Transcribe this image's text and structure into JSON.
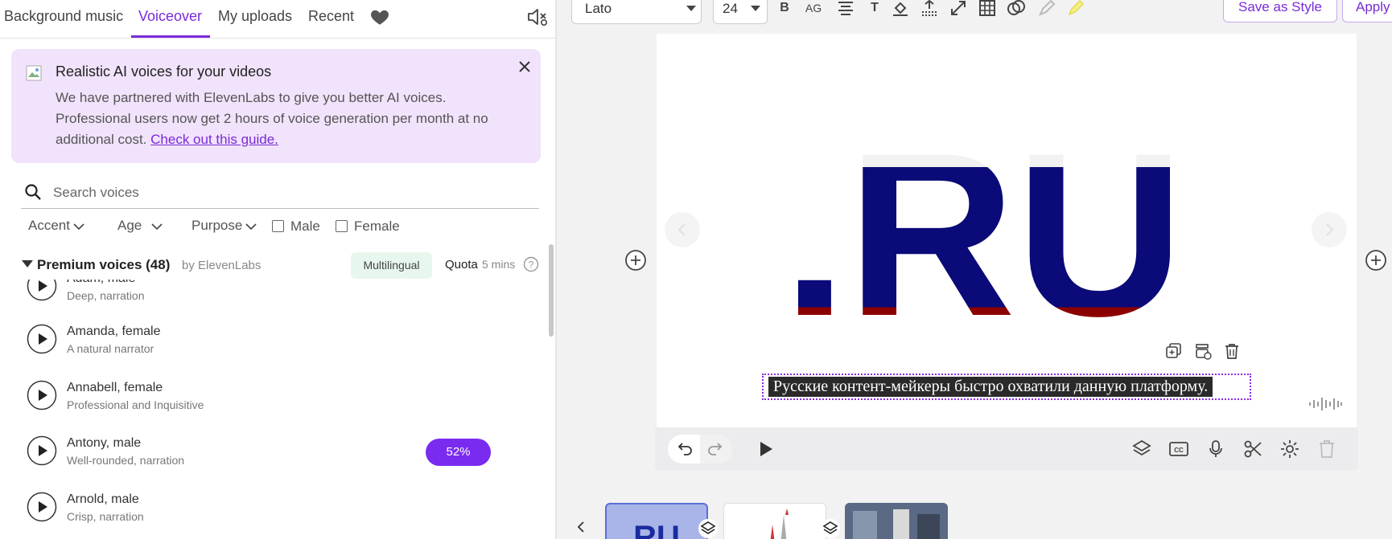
{
  "tabs": [
    {
      "label": "Background music"
    },
    {
      "label": "Voiceover"
    },
    {
      "label": "My uploads"
    },
    {
      "label": "Recent"
    }
  ],
  "active_tab": "Voiceover",
  "banner": {
    "title": "Realistic AI voices for your videos",
    "body": "We have partnered with ElevenLabs to give you better AI voices. Professional users now get 2 hours of voice generation per month at no additional cost. ",
    "link": "Check out this guide."
  },
  "search": {
    "placeholder": "Search voices"
  },
  "filters": {
    "accent": "Accent",
    "age": "Age",
    "purpose": "Purpose",
    "male": "Male",
    "female": "Female"
  },
  "section": {
    "title": "Premium voices (48)",
    "by": "by ElevenLabs",
    "badge": "Multilingual",
    "quota_label": "Quota",
    "quota_value": "5 mins"
  },
  "voices": [
    {
      "name": "Adam, male",
      "desc": "Deep, narration"
    },
    {
      "name": "Amanda, female",
      "desc": "A natural narrator"
    },
    {
      "name": "Annabell, female",
      "desc": "Professional and Inquisitive"
    },
    {
      "name": "Antony, male",
      "desc": "Well-rounded, narration",
      "progress": "52%"
    },
    {
      "name": "Arnold, male",
      "desc": "Crisp, narration"
    }
  ],
  "toolbar": {
    "font": "Lato",
    "size": "24",
    "bold": "B",
    "caps": "AG",
    "text": "T",
    "save_style": "Save as Style",
    "apply": "Apply"
  },
  "subtitle": "Русские контент-мейкеры быстро охватили данную платформу.",
  "logo_text": ".RU",
  "thumb1_text": "RU",
  "colors": {
    "accent": "#7a2bd9",
    "banner_bg": "#f1e3fb",
    "progress": "#7a2bf0",
    "ru_blue": "#0a0a78",
    "ru_red": "#8b0000"
  }
}
